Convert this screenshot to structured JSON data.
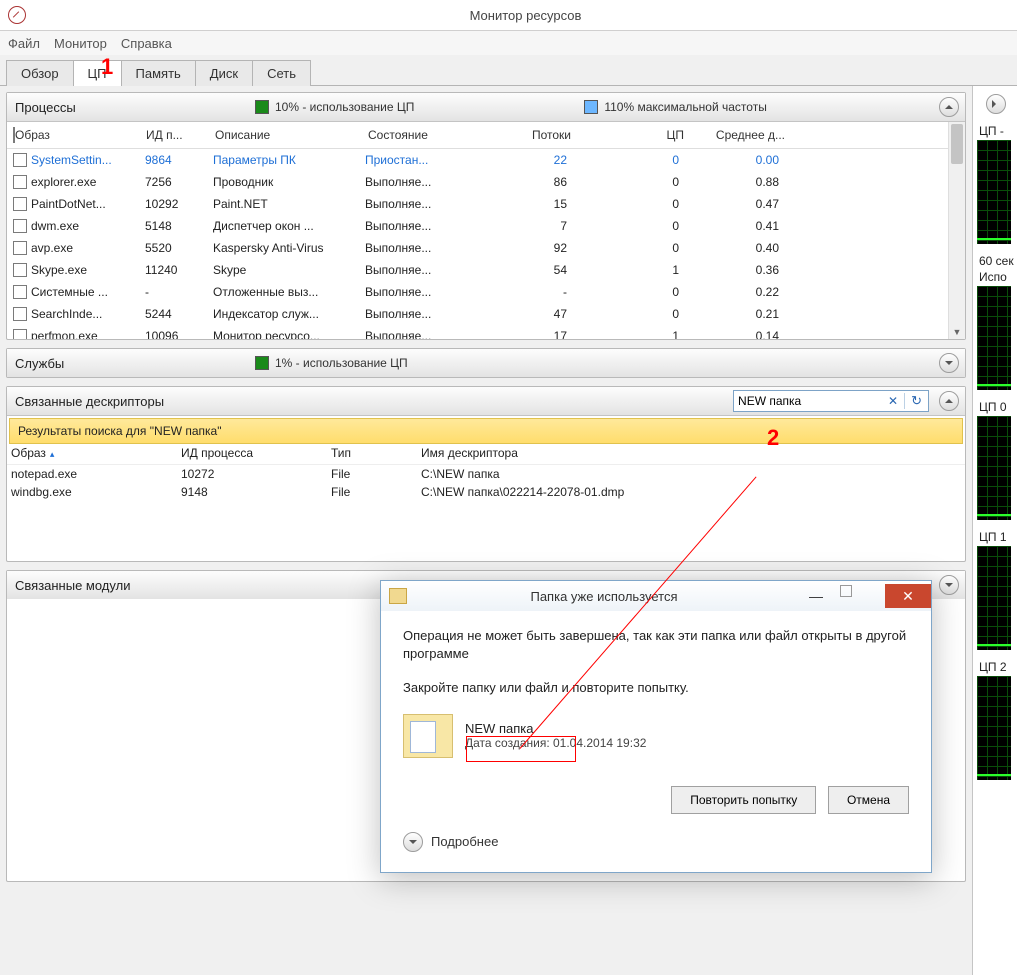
{
  "window": {
    "title": "Монитор ресурсов"
  },
  "menu": {
    "file": "Файл",
    "monitor": "Монитор",
    "help": "Справка"
  },
  "tabs": {
    "overview": "Обзор",
    "cpu": "ЦП",
    "memory": "Память",
    "disk": "Диск",
    "net": "Сеть"
  },
  "annot": {
    "one": "1",
    "two": "2"
  },
  "processesPanel": {
    "title": "Процессы",
    "cpuUsage": "10% - использование ЦП",
    "maxFreq": "110% максимальной частоты",
    "cols": {
      "image": "Образ",
      "pid": "ИД п...",
      "desc": "Описание",
      "state": "Состояние",
      "threads": "Потоки",
      "cpu": "ЦП",
      "avg": "Среднее д..."
    }
  },
  "processes": [
    {
      "image": "SystemSettin...",
      "pid": "9864",
      "desc": "Параметры ПК",
      "state": "Приостан...",
      "threads": "22",
      "cpu": "0",
      "avg": "0.00",
      "hl": true
    },
    {
      "image": "explorer.exe",
      "pid": "7256",
      "desc": "Проводник",
      "state": "Выполняе...",
      "threads": "86",
      "cpu": "0",
      "avg": "0.88"
    },
    {
      "image": "PaintDotNet...",
      "pid": "10292",
      "desc": "Paint.NET",
      "state": "Выполняе...",
      "threads": "15",
      "cpu": "0",
      "avg": "0.47"
    },
    {
      "image": "dwm.exe",
      "pid": "5148",
      "desc": "Диспетчер окон ...",
      "state": "Выполняе...",
      "threads": "7",
      "cpu": "0",
      "avg": "0.41"
    },
    {
      "image": "avp.exe",
      "pid": "5520",
      "desc": "Kaspersky Anti-Virus",
      "state": "Выполняе...",
      "threads": "92",
      "cpu": "0",
      "avg": "0.40"
    },
    {
      "image": "Skype.exe",
      "pid": "11240",
      "desc": "Skype",
      "state": "Выполняе...",
      "threads": "54",
      "cpu": "1",
      "avg": "0.36"
    },
    {
      "image": "Системные ...",
      "pid": "-",
      "desc": "Отложенные выз...",
      "state": "Выполняе...",
      "threads": "-",
      "cpu": "0",
      "avg": "0.22"
    },
    {
      "image": "SearchInde...",
      "pid": "5244",
      "desc": "Индексатор служ...",
      "state": "Выполняе...",
      "threads": "47",
      "cpu": "0",
      "avg": "0.21"
    },
    {
      "image": "perfmon.exe",
      "pid": "10096",
      "desc": "Монитор ресурсо...",
      "state": "Выполняе...",
      "threads": "17",
      "cpu": "1",
      "avg": "0.14"
    }
  ],
  "servicesPanel": {
    "title": "Службы",
    "cpuUsage": "1% - использование ЦП"
  },
  "handlesPanel": {
    "title": "Связанные дескрипторы",
    "searchValue": "NEW папка",
    "resultsLabel": "Результаты поиска для \"NEW папка\"",
    "cols": {
      "image": "Образ",
      "pid": "ИД процесса",
      "type": "Тип",
      "name": "Имя дескриптора"
    }
  },
  "handles": [
    {
      "image": "notepad.exe",
      "pid": "10272",
      "type": "File",
      "name": "C:\\NEW папка"
    },
    {
      "image": "windbg.exe",
      "pid": "9148",
      "type": "File",
      "name": "C:\\NEW папка\\022214-22078-01.dmp"
    }
  ],
  "modulesPanel": {
    "title": "Связанные модули"
  },
  "side": {
    "cpuTotal": "ЦП -",
    "sec60": "60 сек",
    "usage": "Испо",
    "cpu0": "ЦП 0",
    "cpu1": "ЦП 1",
    "cpu2": "ЦП 2"
  },
  "dialog": {
    "title": "Папка уже используется",
    "line1": "Операция не может быть завершена, так как эти папка или файл открыты в другой программе",
    "line2": "Закройте папку или файл и повторите попытку.",
    "folderName": "NEW папка",
    "created": "Дата создания: 01.04.2014 19:32",
    "retry": "Повторить попытку",
    "cancel": "Отмена",
    "more": "Подробнее"
  }
}
